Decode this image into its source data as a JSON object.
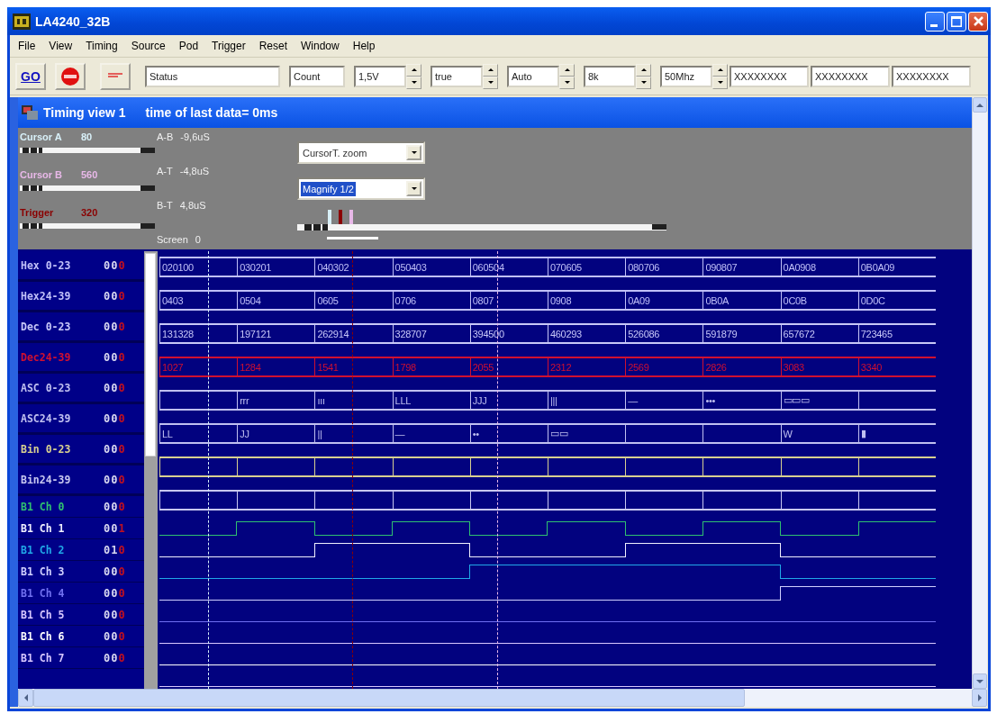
{
  "window": {
    "title": "LA4240_32B"
  },
  "menu": [
    "File",
    "View",
    "Timing",
    "Source",
    "Pod",
    "Trigger",
    "Reset",
    "Window",
    "Help"
  ],
  "toolbar": {
    "go": "GO",
    "status": "Status",
    "count": "Count",
    "spins": [
      {
        "value": "1,5V"
      },
      {
        "value": "true"
      },
      {
        "value": "Auto"
      },
      {
        "value": "8k"
      },
      {
        "value": "50Mhz"
      }
    ],
    "fields": [
      "XXXXXXXX",
      "XXXXXXXX",
      "XXXXXXXX"
    ]
  },
  "timing_view": {
    "title": "Timing view  1",
    "info": "time of last data= 0ms"
  },
  "cursors": [
    {
      "label": "Cursor A",
      "value": "80",
      "color": "#d8f0f8",
      "level": 0.02
    },
    {
      "label": "Cursor B",
      "value": "560",
      "color": "#e8b8e8",
      "level": 0.02
    },
    {
      "label": "Trigger",
      "value": "320",
      "color": "#8a0000",
      "level": 0.02
    }
  ],
  "deltas": [
    {
      "label": "A-B",
      "value": "-9,6uS"
    },
    {
      "label": "A-T",
      "value": "-4,8uS"
    },
    {
      "label": "B-T",
      "value": "4,8uS"
    },
    {
      "label": "Screen",
      "value": "0"
    }
  ],
  "zoom_select": {
    "value": "CursorT. zoom",
    "highlighted": false
  },
  "magnify_select": {
    "value": "Magnify 1/2",
    "highlighted": true
  },
  "overview": {
    "level": 0.02
  },
  "rows": [
    {
      "kind": "bus",
      "name": "Hex 0-23",
      "color": "#c0c0f8",
      "readout": "000",
      "cells": [
        "020100",
        "030201",
        "040302",
        "050403",
        "060504",
        "070605",
        "080706",
        "090807",
        "0A0908",
        "0B0A09"
      ]
    },
    {
      "kind": "bus",
      "name": "Hex24-39",
      "color": "#c0c0f8",
      "readout": "000",
      "cells": [
        "0403",
        "0504",
        "0605",
        "0706",
        "0807",
        "0908",
        "0A09",
        "0B0A",
        "0C0B",
        "0D0C"
      ]
    },
    {
      "kind": "bus",
      "name": "Dec 0-23",
      "color": "#c8c8f8",
      "readout": "000",
      "cells": [
        "131328",
        "197121",
        "262914",
        "328707",
        "394500",
        "460293",
        "526086",
        "591879",
        "657672",
        "723465"
      ]
    },
    {
      "kind": "bus",
      "name": "Dec24-39",
      "color": "#d01030",
      "readout": "000",
      "cells": [
        "1027",
        "1284",
        "1541",
        "1798",
        "2055",
        "2312",
        "2569",
        "2826",
        "3083",
        "3340"
      ]
    },
    {
      "kind": "bus",
      "name": "ASC 0-23",
      "color": "#c0c0f0",
      "readout": "000",
      "cells": [
        null,
        "rrr",
        "ııı",
        "LLL",
        "JJJ",
        "|||",
        "—",
        "•••",
        "▭▭▭",
        null
      ]
    },
    {
      "kind": "bus",
      "name": "ASC24-39",
      "color": "#c0c0f0",
      "readout": "000",
      "cells": [
        "LL",
        "JJ",
        "||",
        "—",
        "••",
        "▭▭",
        null,
        null,
        "W",
        "▮"
      ]
    },
    {
      "kind": "bus",
      "name": "Bin 0-23",
      "color": "#d8d090",
      "readout": "000"
    },
    {
      "kind": "bus",
      "name": "Bin24-39",
      "color": "#c8c8f0",
      "readout": "000"
    },
    {
      "kind": "channel",
      "name": "B1 Ch 0",
      "color": "#30c070",
      "readout": "000",
      "high": [
        false,
        true,
        false,
        true,
        false,
        true,
        false,
        true,
        false,
        true
      ]
    },
    {
      "kind": "channel",
      "name": "B1 Ch 1",
      "color": "#f0f0ff",
      "readout": "001",
      "high": [
        false,
        false,
        true,
        true,
        false,
        false,
        true,
        true,
        false,
        false
      ]
    },
    {
      "kind": "channel",
      "name": "B1 Ch 2",
      "color": "#20a8e8",
      "readout": "010",
      "high": [
        false,
        false,
        false,
        false,
        true,
        true,
        true,
        true,
        false,
        false
      ]
    },
    {
      "kind": "channel",
      "name": "B1 Ch 3",
      "color": "#d0d0ff",
      "readout": "000",
      "high": [
        false,
        false,
        false,
        false,
        false,
        false,
        false,
        false,
        true,
        true
      ]
    },
    {
      "kind": "channel",
      "name": "B1 Ch 4",
      "color": "#7070f0",
      "readout": "000",
      "high": [
        false,
        false,
        false,
        false,
        false,
        false,
        false,
        false,
        false,
        false
      ]
    },
    {
      "kind": "channel",
      "name": "B1 Ch 5",
      "color": "#d8c8ff",
      "readout": "000",
      "high": [
        false,
        false,
        false,
        false,
        false,
        false,
        false,
        false,
        false,
        false
      ]
    },
    {
      "kind": "channel",
      "name": "B1 Ch 6",
      "color": "#ffffff",
      "readout": "000",
      "high": [
        false,
        false,
        false,
        false,
        false,
        false,
        false,
        false,
        false,
        false
      ]
    },
    {
      "kind": "channel",
      "name": "B1 Ch 7",
      "color": "#d8c8ff",
      "readout": "000",
      "high": [
        false,
        false,
        false,
        false,
        false,
        false,
        false,
        false,
        false,
        false
      ]
    }
  ]
}
